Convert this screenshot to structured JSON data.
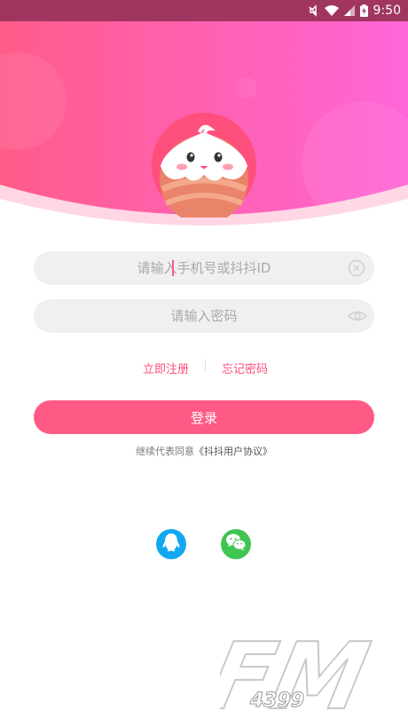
{
  "status_bar": {
    "time": "9:50"
  },
  "login_form": {
    "phone_placeholder": "请输入手机号或抖抖ID",
    "password_placeholder": "请输入密码"
  },
  "links": {
    "register": "立即注册",
    "forgot_password": "忘记密码"
  },
  "login_button": "登录",
  "agreement": {
    "prefix": "继续代表同意",
    "link": "《抖抖用户协议》"
  },
  "social": [
    "qq-icon",
    "wechat-icon"
  ],
  "watermark": {
    "brand": "FM",
    "number": "4399"
  },
  "colors": {
    "accent": "#ff5a86",
    "gradient_start": "#ff5c8a",
    "gradient_end": "#ff66d8",
    "qq_blue": "#12a7f0",
    "wechat_green": "#40c452"
  }
}
